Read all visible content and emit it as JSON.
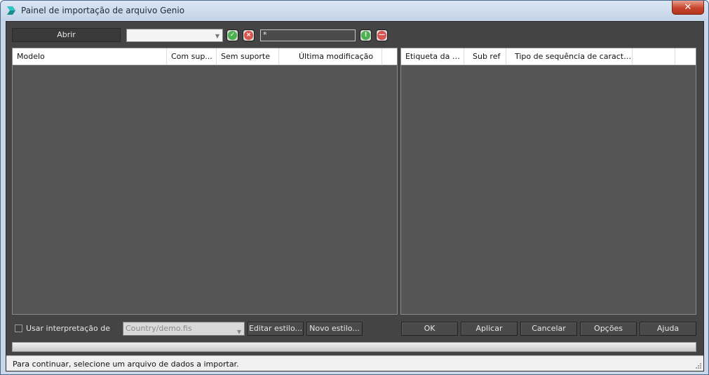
{
  "window": {
    "title": "Painel de importação de arquivo Genio",
    "close_label": "✕"
  },
  "toolbar": {
    "open_label": "Abrir",
    "file_combo_value": "",
    "filter_value": "*"
  },
  "left_list": {
    "columns": [
      "Modelo",
      "Com sup...",
      "Sem suporte",
      "Última modificação",
      ""
    ]
  },
  "right_list": {
    "columns": [
      "Etiqueta da s...",
      "Sub ref",
      "Tipo de sequência de caracteres",
      ""
    ]
  },
  "bottom": {
    "use_interpretation_label": "Usar interpretação de",
    "use_interpretation_checked": false,
    "style_combo_value": "Country/demo.fis",
    "edit_style_label": "Editar estilo...",
    "new_style_label": "Novo estilo...",
    "ok_label": "OK",
    "apply_label": "Aplicar",
    "cancel_label": "Cancelar",
    "options_label": "Opções",
    "help_label": "Ajuda"
  },
  "progress": {
    "value": 0
  },
  "status": {
    "text": "Para continuar, selecione um arquivo de dados a importar."
  },
  "icons": {
    "accept": "check-icon",
    "reject": "x-circle-icon",
    "filter_accept": "info-down-icon",
    "filter_remove": "minus-circle-icon"
  },
  "colors": {
    "accept_green": "#4caf50",
    "reject_red": "#d9534f",
    "client_bg": "#444444",
    "list_bg": "#555555"
  }
}
